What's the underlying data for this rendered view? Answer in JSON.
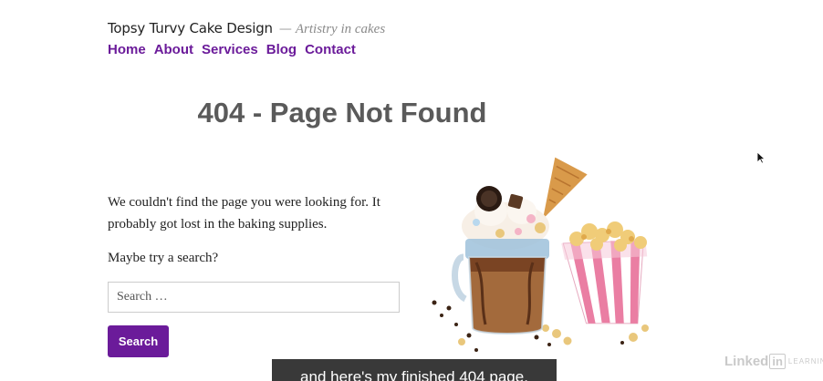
{
  "site": {
    "title": "Topsy Turvy Cake Design",
    "separator": "—",
    "tagline": "Artistry in cakes"
  },
  "nav": {
    "items": [
      {
        "label": "Home"
      },
      {
        "label": "About"
      },
      {
        "label": "Services"
      },
      {
        "label": "Blog"
      },
      {
        "label": "Contact"
      }
    ]
  },
  "page": {
    "title": "404 - Page Not Found",
    "message": "We couldn't find the page you were looking for. It probably got lost in the baking supplies.",
    "hint": "Maybe try a search?"
  },
  "search": {
    "placeholder": "Search …",
    "button_label": "Search"
  },
  "illustration": {
    "icon": "freakshake-and-popcorn-image"
  },
  "caption": {
    "text": "and here's my finished 404 page."
  },
  "watermark": {
    "linked": "Linked",
    "in": "in",
    "learning": "LEARNING"
  },
  "colors": {
    "accent": "#6b1b9a",
    "heading": "#5a5a5a",
    "text": "#222222"
  }
}
